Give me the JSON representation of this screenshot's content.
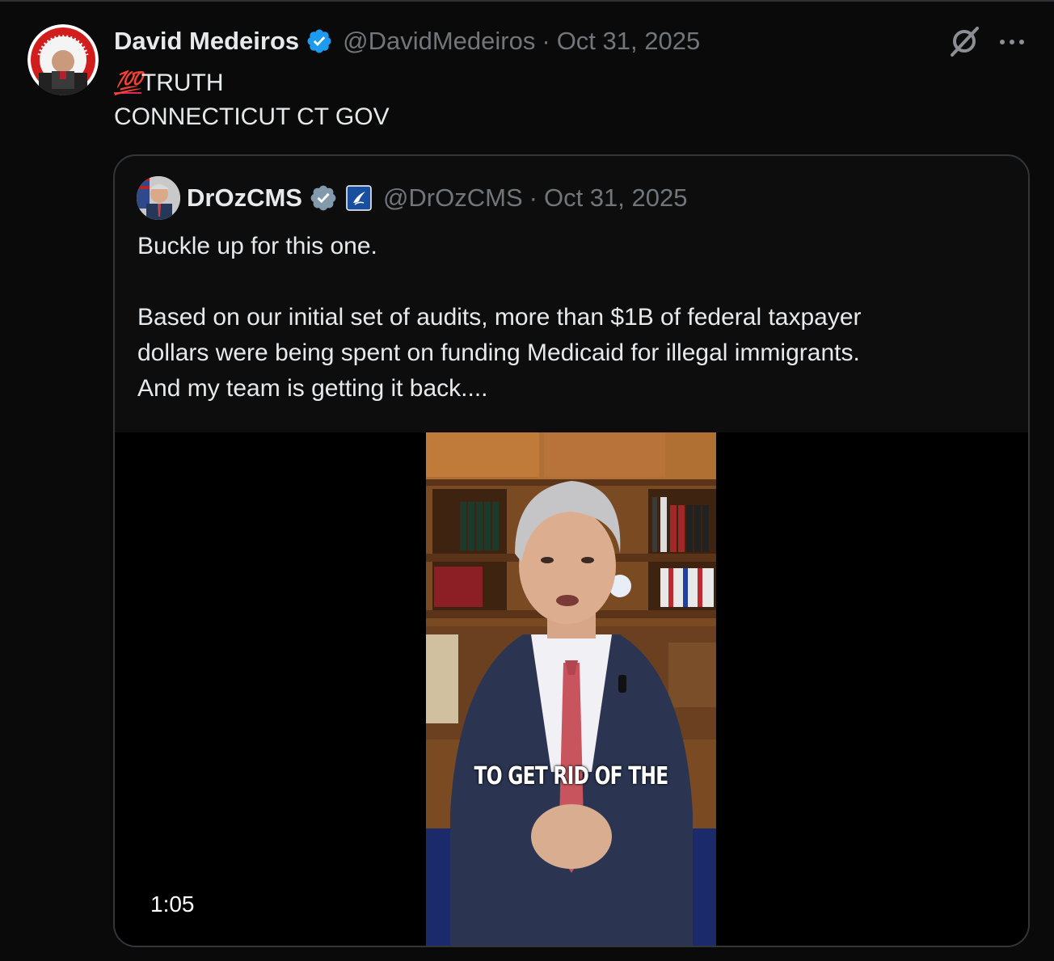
{
  "post": {
    "author_name": "David Medeiros",
    "handle": "@DavidMedeiros",
    "separator": "·",
    "date": "Oct 31, 2025",
    "emoji": "💯",
    "line1": "TRUTH",
    "line2": "CONNECTICUT CT GOV",
    "icons": [
      "verified-badge-icon",
      "grok-icon",
      "more-icon"
    ],
    "colors": {
      "verified": "#1d9bf0",
      "background": "#0a0a0a",
      "muted": "#71767b"
    }
  },
  "quote": {
    "author_name": "DrOzCMS",
    "handle": "@DrOzCMS",
    "separator": "·",
    "date": "Oct 31, 2025",
    "paragraph1": "Buckle up for this one.",
    "paragraph2_line1": "Based on our initial set of audits, more than $1B of federal taxpayer",
    "paragraph2_line2": "dollars were being spent on funding Medicaid for illegal immigrants.",
    "paragraph2_line3": "And my team is getting it back....",
    "icons": [
      "gray-verified-badge-icon",
      "government-affiliation-badge-icon"
    ],
    "colors": {
      "verified": "#829aab"
    },
    "video": {
      "caption": "TO GET RID OF THE",
      "duration": "1:05"
    }
  }
}
